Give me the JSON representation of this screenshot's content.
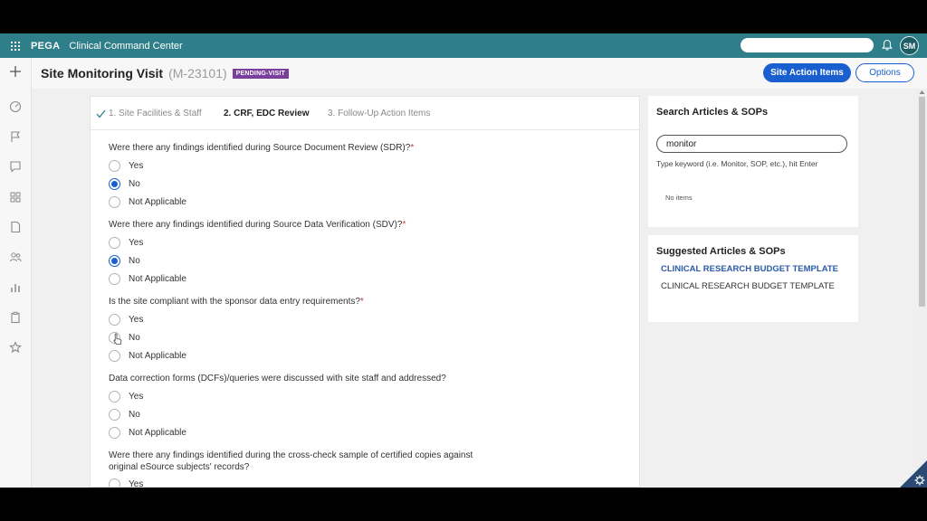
{
  "topbar": {
    "brand": "PEGA",
    "app_name": "Clinical Command Center",
    "avatar_initials": "SM",
    "search_placeholder": ""
  },
  "header": {
    "title": "Site Monitoring Visit",
    "case_id": "(M-23101)",
    "status": "PENDING-VISIT",
    "action_button": "Site Action Items",
    "options_button": "Options"
  },
  "steps": [
    {
      "label": "1. Site Facilities & Staff",
      "state": "done"
    },
    {
      "label": "2. CRF, EDC Review",
      "state": "current"
    },
    {
      "label": "3. Follow-Up Action Items",
      "state": "upcoming"
    }
  ],
  "questions": [
    {
      "text": "Were there any findings identified during Source Document Review (SDR)?",
      "required": "*",
      "options": [
        "Yes",
        "No",
        "Not Applicable"
      ],
      "selected": "No"
    },
    {
      "text": "Were there any findings identified during Source Data Verification (SDV)?",
      "required": "*",
      "options": [
        "Yes",
        "No",
        "Not Applicable"
      ],
      "selected": "No"
    },
    {
      "text": "Is the site compliant with the sponsor data entry requirements?",
      "required": "*",
      "options": [
        "Yes",
        "No",
        "Not Applicable"
      ],
      "selected": ""
    },
    {
      "text": "Data correction forms (DCFs)/queries were discussed with site staff and addressed?",
      "required": "",
      "options": [
        "Yes",
        "No",
        "Not Applicable"
      ],
      "selected": ""
    },
    {
      "text": "Were there any findings identified during the cross-check sample of certified copies against original eSource subjects' records?",
      "required": "",
      "options": [
        "Yes"
      ],
      "selected": ""
    }
  ],
  "knowledge": {
    "search_title": "Search Articles & SOPs",
    "search_value": "monitor",
    "search_hint": "Type keyword (i.e. Monitor, SOP, etc.), hit Enter",
    "no_items": "No items",
    "suggest_title": "Suggested Articles & SOPs",
    "suggest_link": "CLINICAL RESEARCH BUDGET TEMPLATE",
    "suggest_text": "CLINICAL RESEARCH BUDGET TEMPLATE"
  },
  "colors": {
    "topbar": "#2f7f8a",
    "accent": "#1a5fcf",
    "badge": "#7a3f9d",
    "required": "#c23a3a"
  }
}
